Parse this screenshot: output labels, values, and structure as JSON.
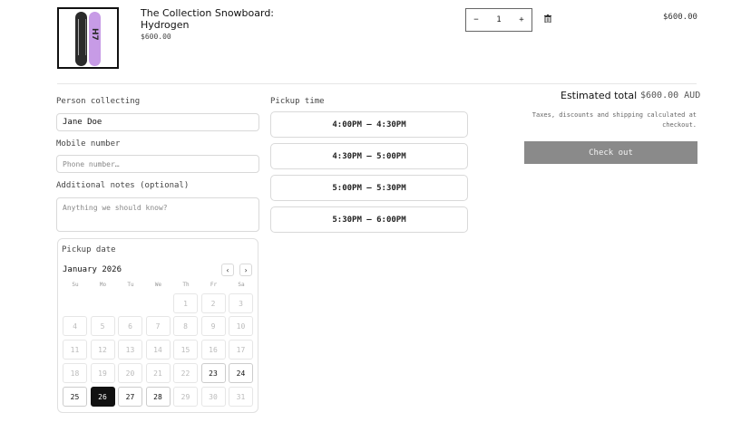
{
  "cart": {
    "item": {
      "title": "The Collection Snowboard: Hydrogen",
      "price": "$600.00",
      "quantity": "1",
      "line_total": "$600.00"
    },
    "decrement_label": "−",
    "increment_label": "+"
  },
  "form": {
    "person_label": "Person collecting",
    "person_value": "Jane Doe",
    "mobile_label": "Mobile number",
    "mobile_placeholder": "Phone number…",
    "notes_label": "Additional notes (optional)",
    "notes_placeholder": "Anything we should know?"
  },
  "calendar": {
    "title": "Pickup date",
    "month": "January 2026",
    "prev_label": "‹",
    "next_label": "›",
    "weekdays": [
      "Su",
      "Mo",
      "Tu",
      "We",
      "Th",
      "Fr",
      "Sa"
    ],
    "days": [
      "1",
      "2",
      "3",
      "4",
      "5",
      "6",
      "7",
      "8",
      "9",
      "10",
      "11",
      "12",
      "13",
      "14",
      "15",
      "16",
      "17",
      "18",
      "19",
      "20",
      "21",
      "22",
      "23",
      "24",
      "25",
      "26",
      "27",
      "28",
      "29",
      "30",
      "31"
    ],
    "selected_day": "26",
    "available_days": [
      "23",
      "24",
      "25",
      "26",
      "27",
      "28"
    ]
  },
  "pickup_time": {
    "label": "Pickup time",
    "slots": [
      "4:00PM – 4:30PM",
      "4:30PM – 5:00PM",
      "5:00PM – 5:30PM",
      "5:30PM – 6:00PM"
    ]
  },
  "summary": {
    "estimated_label": "Estimated total",
    "estimated_value": "$600.00 AUD",
    "tax_note": "Taxes, discounts and shipping calculated at checkout.",
    "checkout_label": "Check out"
  },
  "colors": {
    "selected_day_bg": "#111111",
    "checkout_bg": "#8a8a8a"
  },
  "icons": {
    "remove": "trash-icon"
  }
}
